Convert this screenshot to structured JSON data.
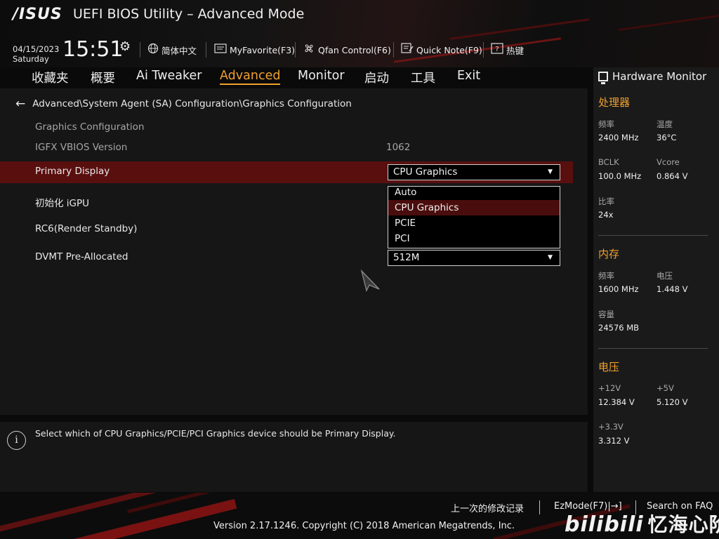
{
  "header": {
    "brand": "/ISUS",
    "title": "UEFI BIOS Utility – Advanced Mode",
    "date": "04/15/2023",
    "weekday": "Saturday",
    "time": "15:51",
    "tools": [
      {
        "icon": "globe-icon",
        "label": "简体中文"
      },
      {
        "icon": "favorite-icon",
        "label": "MyFavorite(F3)"
      },
      {
        "icon": "fan-icon",
        "label": "Qfan Control(F6)"
      },
      {
        "icon": "note-icon",
        "label": "Quick Note(F9)"
      },
      {
        "icon": "help-icon",
        "label": "热键"
      }
    ]
  },
  "menu": {
    "tabs": [
      "收藏夹",
      "概要",
      "Ai Tweaker",
      "Advanced",
      "Monitor",
      "启动",
      "工具",
      "Exit"
    ],
    "active": "Advanced"
  },
  "main": {
    "breadcrumb": "Advanced\\System Agent (SA) Configuration\\Graphics Configuration",
    "section_title": "Graphics Configuration",
    "vbios": {
      "label": "IGFX VBIOS Version",
      "value": "1062"
    },
    "primary_display": {
      "label": "Primary Display",
      "value": "CPU Graphics"
    },
    "init_igpu": {
      "label": "初始化 iGPU"
    },
    "rc6": {
      "label": "RC6(Render Standby)"
    },
    "dvmt": {
      "label": "DVMT Pre-Allocated",
      "value": "512M"
    },
    "dropdown": {
      "options": [
        "Auto",
        "CPU Graphics",
        "PCIE",
        "PCI"
      ],
      "selected": "CPU Graphics"
    }
  },
  "help": {
    "text": "Select which of CPU Graphics/PCIE/PCI Graphics device should be Primary Display."
  },
  "hardware_monitor": {
    "title": "Hardware Monitor",
    "cpu": {
      "title": "处理器",
      "freq_label": "频率",
      "freq": "2400 MHz",
      "temp_label": "温度",
      "temp": "36°C",
      "bclk_label": "BCLK",
      "bclk": "100.0 MHz",
      "vcore_label": "Vcore",
      "vcore": "0.864 V",
      "ratio_label": "比率",
      "ratio": "24x"
    },
    "memory": {
      "title": "内存",
      "freq_label": "频率",
      "freq": "1600 MHz",
      "volt_label": "电压",
      "volt": "1.448 V",
      "cap_label": "容量",
      "cap": "24576 MB"
    },
    "voltage": {
      "title": "电压",
      "v12_label": "+12V",
      "v12": "12.384 V",
      "v5_label": "+5V",
      "v5": "5.120 V",
      "v33_label": "+3.3V",
      "v33": "3.312 V"
    }
  },
  "footer": {
    "last_modified": "上一次的修改记录",
    "ezmode": "EzMode(F7)|→]",
    "search_faq": "Search on FAQ",
    "copyright": "Version 2.17.1246. Copyright (C) 2018 American Megatrends, Inc.",
    "watermark": "忆海心阶",
    "watermark_logo": "bilibili"
  },
  "colors": {
    "accent": "#f0a030",
    "highlight_row": "#5a0f0f",
    "dropdown_selected": "#4a0d0d"
  }
}
